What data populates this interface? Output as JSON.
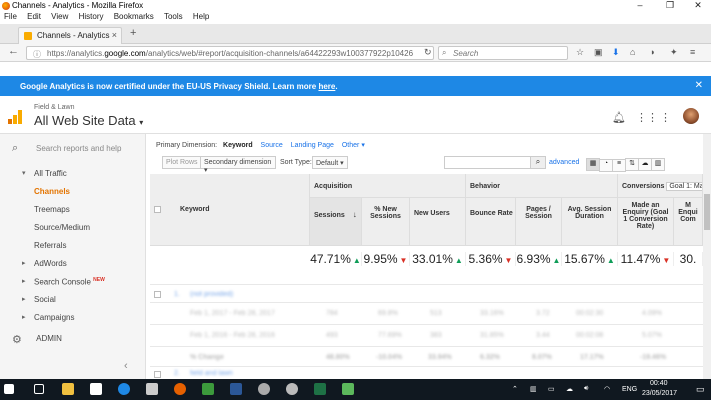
{
  "window": {
    "title": "Channels - Analytics - Mozilla Firefox",
    "menu": [
      "File",
      "Edit",
      "View",
      "History",
      "Bookmarks",
      "Tools",
      "Help"
    ]
  },
  "browser": {
    "tab_title": "Channels - Analytics",
    "url_prefix": "https://analytics.",
    "url_domain": "google.com",
    "url_suffix": "/analytics/web/#report/acquisition-channels/a64422293w100377922p10426",
    "search_placeholder": "Search"
  },
  "banner": {
    "text": "Google Analytics is now certified under the EU-US Privacy Shield. Learn more ",
    "link": "here",
    "end": "."
  },
  "header": {
    "account": "Field & Lawn",
    "property": "All Web Site Data"
  },
  "sidebar": {
    "search_placeholder": "Search reports and help",
    "items": [
      {
        "label": "All Traffic"
      },
      {
        "label": "Channels"
      },
      {
        "label": "Treemaps"
      },
      {
        "label": "Source/Medium"
      },
      {
        "label": "Referrals"
      },
      {
        "label": "AdWords"
      },
      {
        "label": "Search Console",
        "badge": "NEW"
      },
      {
        "label": "Social"
      },
      {
        "label": "Campaigns"
      }
    ],
    "admin": "ADMIN"
  },
  "toolbar": {
    "primary_dimension_label": "Primary Dimension:",
    "dimensions": [
      "Keyword",
      "Source",
      "Landing Page",
      "Other"
    ],
    "plot_rows": "Plot Rows",
    "secondary_dimension": "Secondary dimension",
    "sort_type_label": "Sort Type:",
    "sort_type_value": "Default",
    "advanced": "advanced"
  },
  "table": {
    "keyword_header": "Keyword",
    "groups": [
      "Acquisition",
      "Behavior",
      "Conversions"
    ],
    "goal_select": "Goal 1: Ma",
    "columns": [
      "Sessions",
      "% New Sessions",
      "New Users",
      "Bounce Rate",
      "Pages / Session",
      "Avg. Session Duration",
      "Made an Enquiry (Goal 1 Conversion Rate)",
      "M Enqui Com"
    ],
    "totals": [
      "47.71%",
      "9.95%",
      "33.01%",
      "5.36%",
      "6.93%",
      "15.67%",
      "11.47%",
      "30."
    ],
    "total_dirs": [
      "up",
      "down",
      "up",
      "down",
      "up",
      "up",
      "down",
      ""
    ],
    "row1_index": "1.",
    "row1_keyword": "(not provided)",
    "row1_sub": [
      "Feb 1, 2017 - Feb 28, 2017",
      "Feb 1, 2016 - Feb 28, 2016",
      "% Change"
    ],
    "row2_index": "2.",
    "row2_keyword": "field and lawn",
    "sub_values": [
      [
        "784",
        "69.8%",
        "513",
        "33.16%",
        "3.72",
        "00:02:30",
        "4.09%"
      ],
      [
        "493",
        "77.69%",
        "383",
        "31.85%",
        "3.44",
        "00:02:08",
        "5.07%"
      ],
      [
        "48.80%",
        "-10.04%",
        "33.94%",
        "6.32%",
        "8.07%",
        "17.17%",
        "-19.46%"
      ]
    ]
  },
  "taskbar": {
    "lang": "ENG",
    "time": "00:40",
    "date": "23/05/2017"
  }
}
